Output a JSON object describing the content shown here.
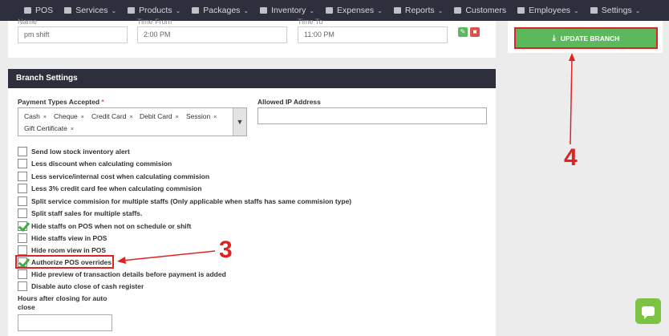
{
  "nav": {
    "items": [
      {
        "label": "POS",
        "icon": "pos-icon",
        "caret": false
      },
      {
        "label": "Services",
        "icon": "services-icon",
        "caret": true
      },
      {
        "label": "Products",
        "icon": "products-icon",
        "caret": true
      },
      {
        "label": "Packages",
        "icon": "packages-icon",
        "caret": true
      },
      {
        "label": "Inventory",
        "icon": "inventory-icon",
        "caret": true
      },
      {
        "label": "Expenses",
        "icon": "expenses-icon",
        "caret": true
      },
      {
        "label": "Reports",
        "icon": "reports-icon",
        "caret": true
      },
      {
        "label": "Customers",
        "icon": "customers-icon",
        "caret": false
      },
      {
        "label": "Employees",
        "icon": "employees-icon",
        "caret": true
      },
      {
        "label": "Settings",
        "icon": "settings-icon",
        "caret": true
      }
    ]
  },
  "shift": {
    "name_label": "Name",
    "time_from_label": "Time From",
    "time_to_label": "Time To",
    "name_value": "pm shift",
    "time_from_value": "2:00 PM",
    "time_to_value": "11:00 PM"
  },
  "update_button": {
    "label": "UPDATE BRANCH"
  },
  "branch_settings": {
    "title": "Branch Settings",
    "payment_types_label": "Payment Types Accepted",
    "required_mark": "*",
    "payment_types": [
      "Cash",
      "Cheque",
      "Credit Card",
      "Debit Card",
      "Session",
      "Gift Certificate"
    ],
    "remove_glyph": "×",
    "allowed_ip_label": "Allowed IP Address",
    "allowed_ip_value": "",
    "options": [
      {
        "label": "Send low stock inventory alert",
        "checked": false
      },
      {
        "label": "Less discount when calculating commision",
        "checked": false
      },
      {
        "label": "Less service/internal cost when calculating commision",
        "checked": false
      },
      {
        "label": "Less 3% credit card fee when calculating commision",
        "checked": false
      },
      {
        "label": "Split service commision for multiple staffs (Only applicable when staffs has same commision type)",
        "checked": false
      },
      {
        "label": "Split staff sales for multiple staffs.",
        "checked": false
      },
      {
        "label": "Hide staffs on POS when not on schedule or shift",
        "checked": true
      },
      {
        "label": "Hide staffs view in POS",
        "checked": false
      },
      {
        "label": "Hide room view in POS",
        "checked": false
      },
      {
        "label": "Authorize POS overrides",
        "checked": true
      },
      {
        "label": "Hide preview of transaction details before payment is added",
        "checked": false
      },
      {
        "label": "Disable auto close of cash register",
        "checked": false
      }
    ],
    "hours_label": "Hours after closing for auto close",
    "hours_value": ""
  },
  "annotations": {
    "step_3": "3",
    "step_4": "4"
  },
  "colors": {
    "navbar": "#2d2f3c",
    "success": "#5cb85c",
    "danger": "#d9534f",
    "annotation": "#e02222",
    "chat": "#7dc242"
  }
}
